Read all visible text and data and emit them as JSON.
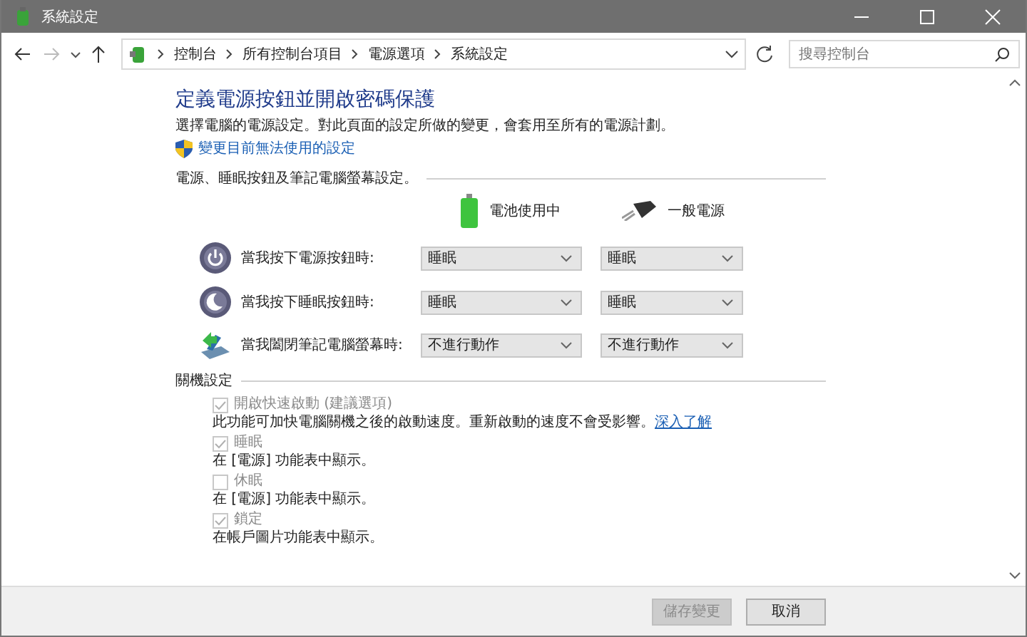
{
  "window": {
    "title": "系統設定"
  },
  "address_bar": {
    "breadcrumbs": [
      "控制台",
      "所有控制台項目",
      "電源選項",
      "系統設定"
    ]
  },
  "search": {
    "placeholder": "搜尋控制台"
  },
  "heading": "定義電源按鈕並開啟密碼保護",
  "description": "選擇電腦的電源設定。對此頁面的設定所做的變更，會套用至所有的電源計劃。",
  "admin_link": "變更目前無法使用的設定",
  "power_section": {
    "title": "電源、睡眠按鈕及筆記電腦螢幕設定。",
    "columns": [
      "電池使用中",
      "一般電源"
    ],
    "rows": [
      {
        "kind": "power",
        "label": "當我按下電源按鈕時:",
        "battery": "睡眠",
        "plugged": "睡眠"
      },
      {
        "kind": "sleep",
        "label": "當我按下睡眠按鈕時:",
        "battery": "睡眠",
        "plugged": "睡眠"
      },
      {
        "kind": "lid",
        "label": "當我闔閉筆記電腦螢幕時:",
        "battery": "不進行動作",
        "plugged": "不進行動作"
      }
    ]
  },
  "shutdown_section": {
    "title": "關機設定",
    "options": [
      {
        "label": "開啟快速啟動 (建議選項)",
        "checked": true,
        "disabled": true,
        "description": "此功能可加快電腦關機之後的啟動速度。重新啟動的速度不會受影響。",
        "link": "深入了解"
      },
      {
        "label": "睡眠",
        "checked": true,
        "disabled": true,
        "description": "在 [電源] 功能表中顯示。"
      },
      {
        "label": "休眠",
        "checked": false,
        "disabled": true,
        "description": "在 [電源] 功能表中顯示。"
      },
      {
        "label": "鎖定",
        "checked": true,
        "disabled": true,
        "description": "在帳戶圖片功能表中顯示。"
      }
    ]
  },
  "buttons": [
    {
      "label": "儲存變更",
      "disabled": true
    },
    {
      "label": "取消",
      "disabled": false
    }
  ]
}
